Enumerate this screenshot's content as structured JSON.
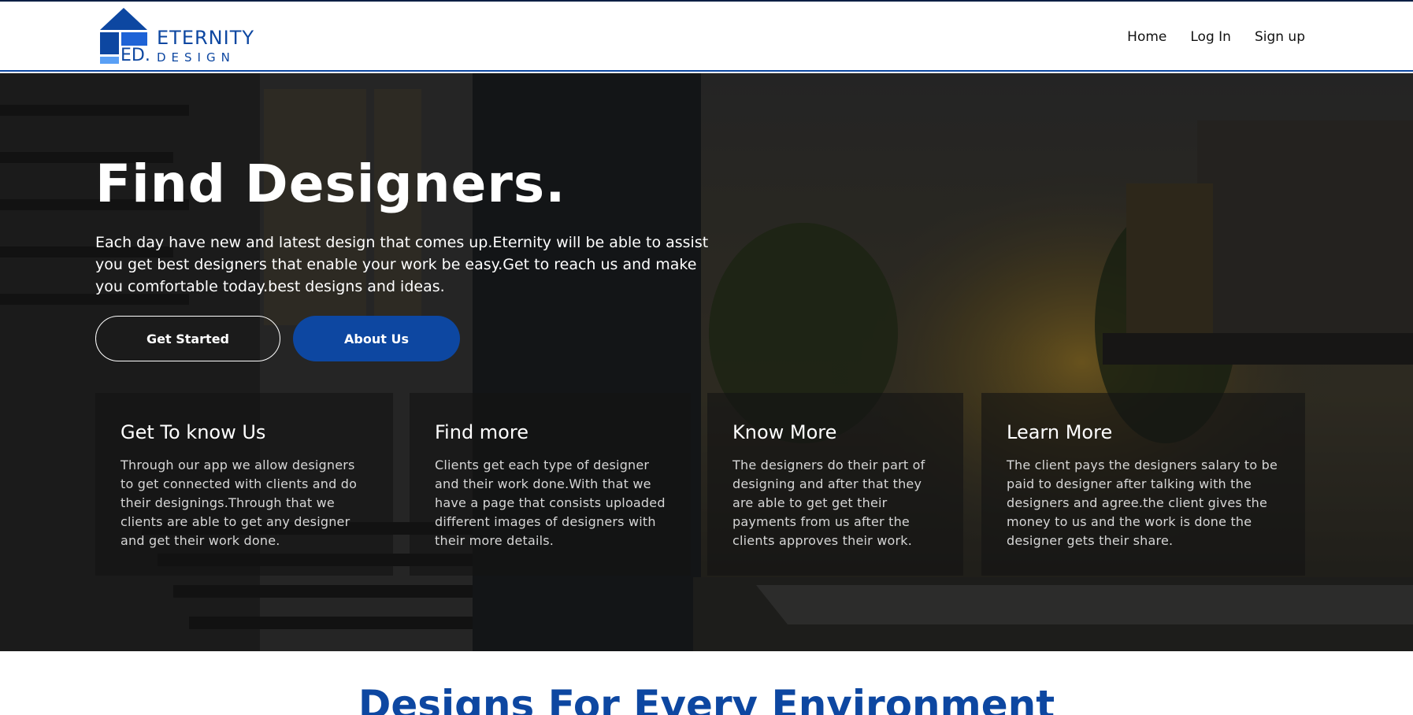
{
  "brand": {
    "name": "ETERNITY",
    "sub": "DESIGN",
    "abbr": "ED.",
    "color": "#0d47a1"
  },
  "nav": {
    "items": [
      {
        "label": "Home"
      },
      {
        "label": "Log In"
      },
      {
        "label": "Sign up"
      }
    ]
  },
  "hero": {
    "title": "Find Designers.",
    "text": "Each day have new and latest design that comes up.Eternity will be able to assist you get best designers that enable your work be easy.Get to reach us and make you comfortable today.best designs and ideas.",
    "buttons": {
      "primary": "Get Started",
      "secondary": "About Us"
    },
    "cards": [
      {
        "title": "Get To know Us",
        "text": "Through our app we allow designers to get connected with clients and do their designings.Through that we clients are able to get any designer and get their work done."
      },
      {
        "title": "Find more",
        "text": "Clients get each type of designer and their work done.With that we have a page that consists uploaded different images of designers with their more details."
      },
      {
        "title": "Know More",
        "text": "The designers do their part of designing and after that they are able to get get their payments from us after the clients approves their work."
      },
      {
        "title": "Learn More",
        "text": "The client pays the designers salary to be paid to designer after talking with the designers and agree.the client gives the money to us and the work is done the designer gets their share."
      }
    ]
  },
  "section": {
    "title": "Designs For Every Environment"
  },
  "colors": {
    "accent": "#0d47a1",
    "topline": "#0a1f44"
  }
}
